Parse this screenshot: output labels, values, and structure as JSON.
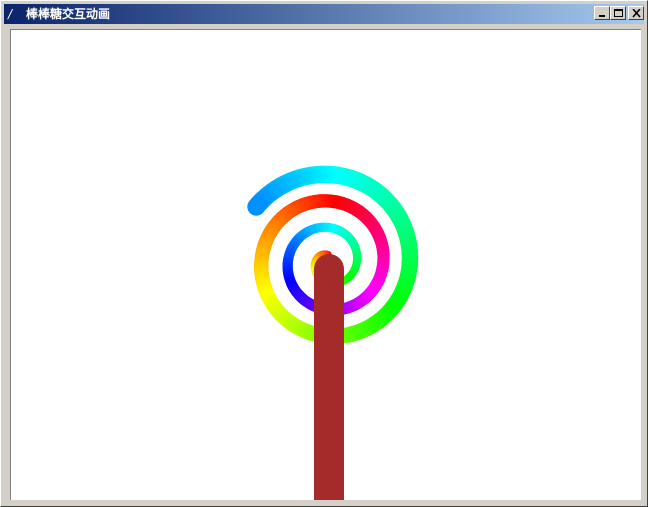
{
  "window": {
    "title": "棒棒糖交互动画",
    "controls": {
      "minimize_icon": "minimize-icon",
      "maximize_icon": "maximize-icon",
      "close_icon": "close-icon"
    }
  },
  "colors": {
    "title_bar_start": "#0a246a",
    "title_bar_end": "#a6caf0",
    "canvas_background": "#ffffff",
    "stick": "#a52a2a",
    "window_frame": "#d4d0c8"
  }
}
